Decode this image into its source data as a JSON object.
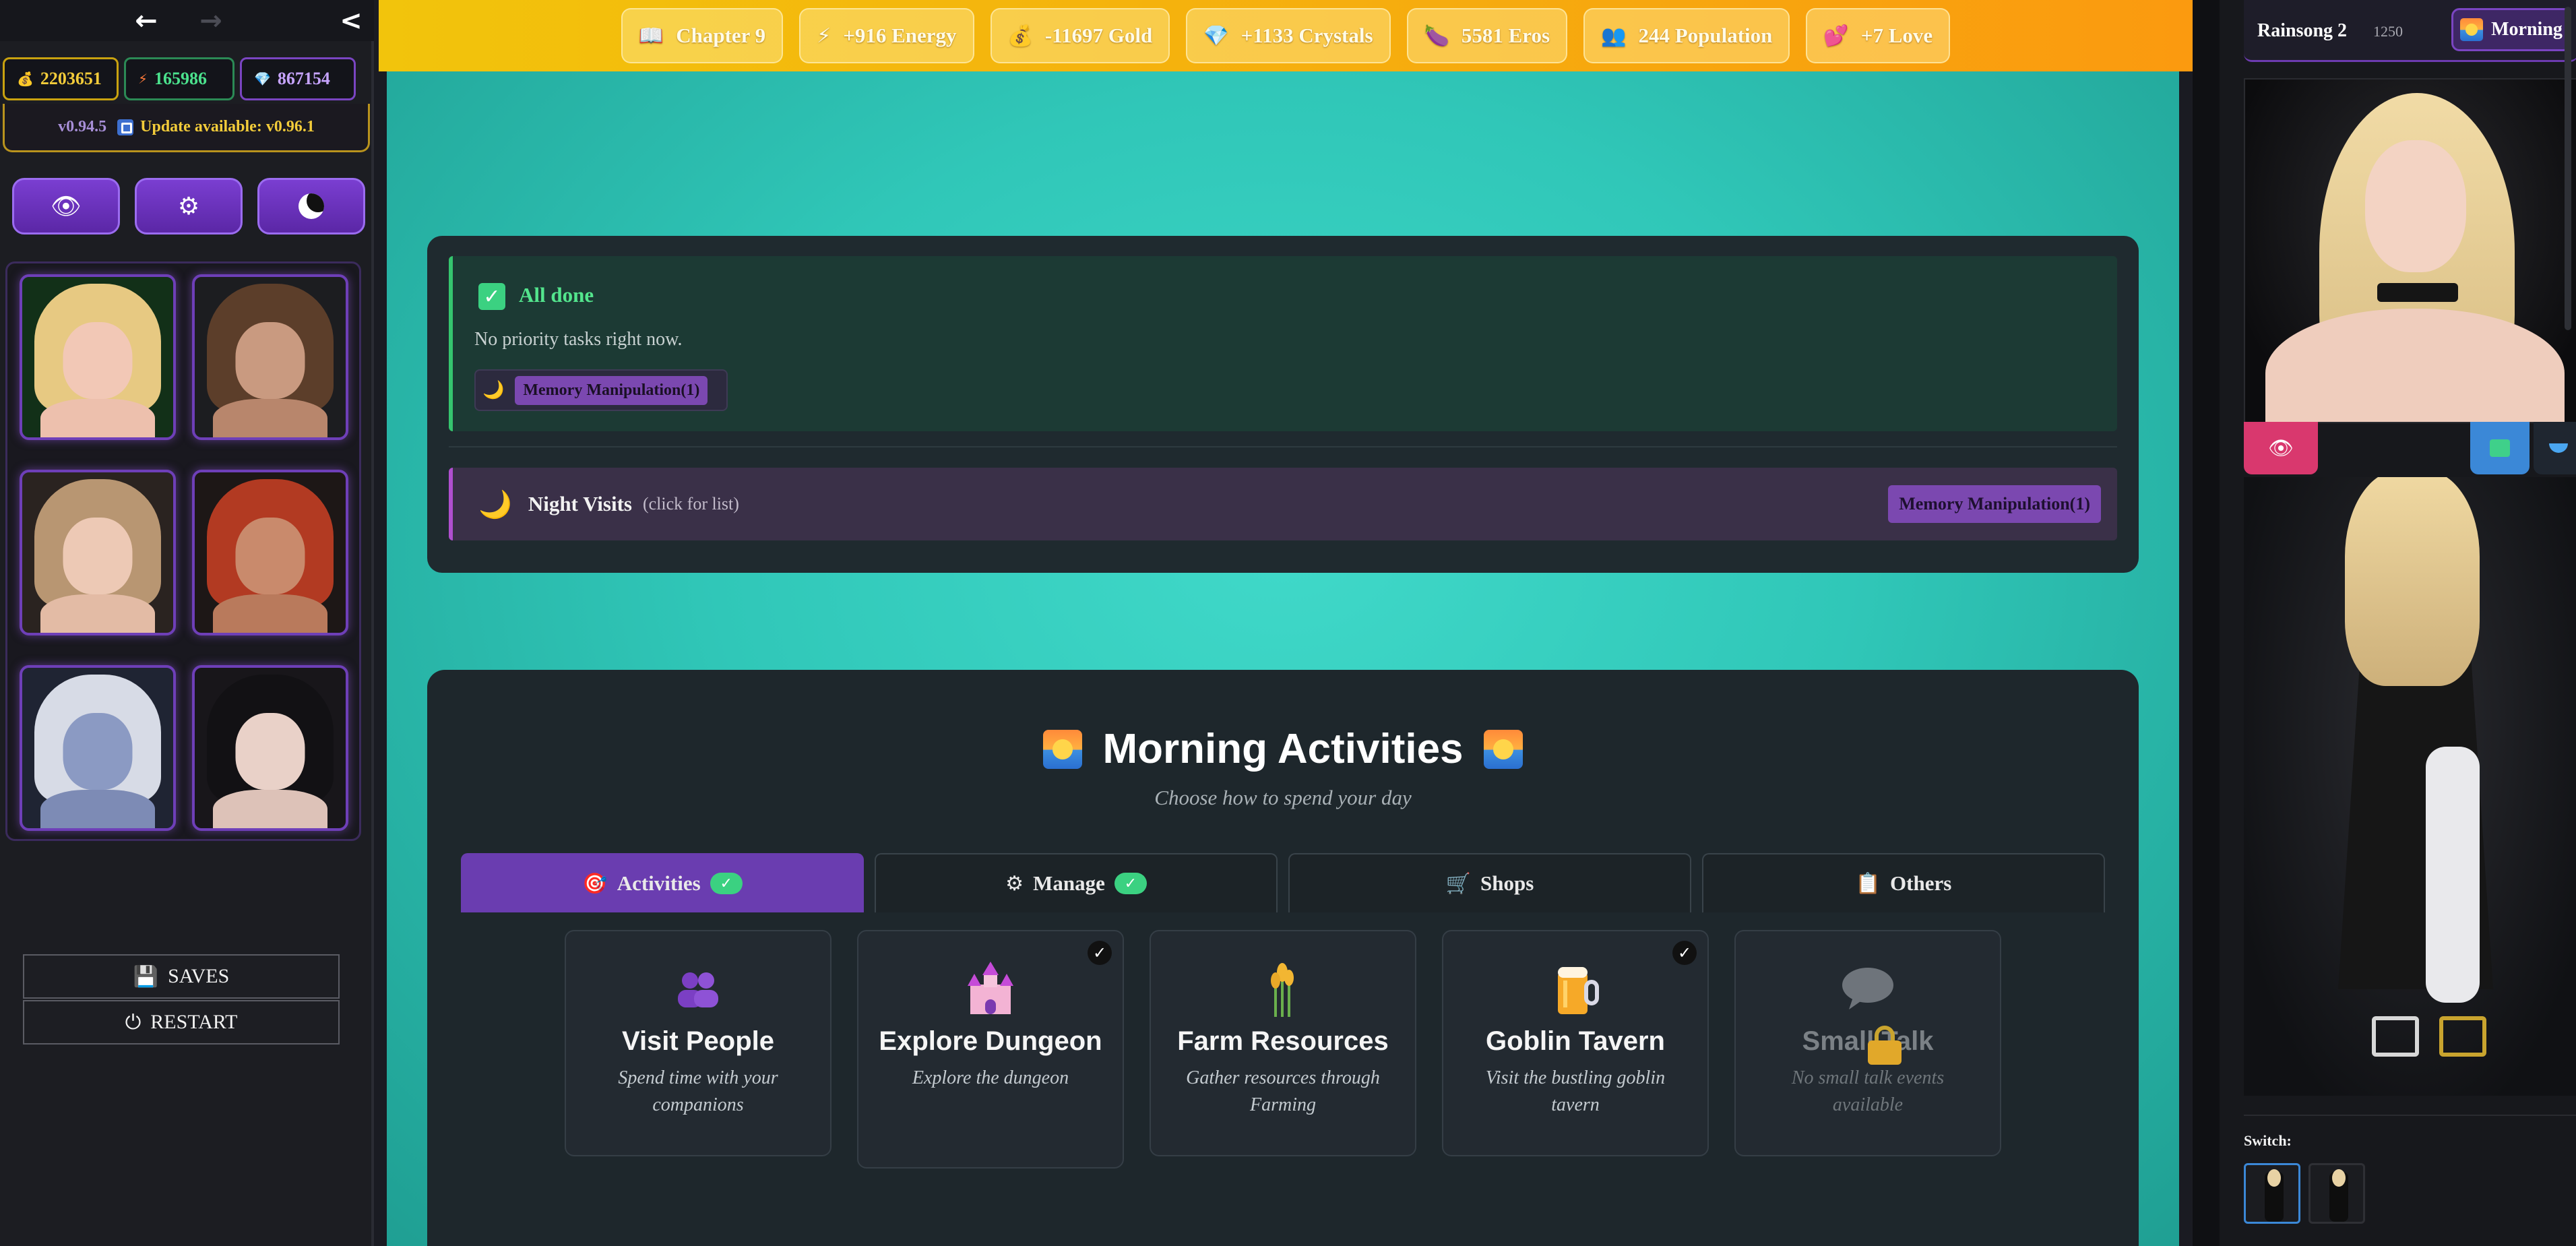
{
  "nav": {
    "back": "←",
    "forward": "→",
    "collapse": "<"
  },
  "currencies": [
    {
      "icon": "💰",
      "value": "2203651"
    },
    {
      "icon": "⚡",
      "value": "165986"
    },
    {
      "icon": "💎",
      "value": "867154"
    }
  ],
  "version": {
    "current": "v0.94.5",
    "update": "Update available: v0.96.1"
  },
  "tools": {
    "eye": "👁",
    "gear": "⚙"
  },
  "system": {
    "saves": "SAVES",
    "restart": "RESTART",
    "saves_icon": "💾",
    "restart_icon": "⏻"
  },
  "resources": [
    {
      "icon": "📖",
      "label": "Chapter 9"
    },
    {
      "icon": "⚡",
      "label": "+916 Energy"
    },
    {
      "icon": "💰",
      "label": "-11697 Gold"
    },
    {
      "icon": "💎",
      "label": "+1133 Crystals"
    },
    {
      "icon": "🍆",
      "label": "5581 Eros"
    },
    {
      "icon": "👥",
      "label": "244 Population"
    },
    {
      "icon": "💕",
      "label": "+7 Love"
    }
  ],
  "priority": {
    "check": "✓",
    "title": "All done",
    "subtitle": "No priority tasks right now.",
    "chip_icon": "🌙",
    "chip_label": "Memory Manipulation(1)"
  },
  "night": {
    "icon": "🌙",
    "title": "Night Visits",
    "hint": "(click for list)",
    "badge": "Memory Manipulation(1)"
  },
  "activities": {
    "title": "Morning Activities",
    "subtitle": "Choose how to spend your day",
    "tabs": [
      {
        "icon": "🎯",
        "label": "Activities",
        "done": "✓"
      },
      {
        "icon": "⚙",
        "label": "Manage",
        "done": "✓"
      },
      {
        "icon": "🛒",
        "label": "Shops"
      },
      {
        "icon": "📋",
        "label": "Others"
      }
    ],
    "cards": [
      {
        "title": "Visit People",
        "desc": "Spend time with your companions",
        "icon": "people-icon"
      },
      {
        "title": "Explore Dungeon",
        "desc": "Explore the dungeon",
        "icon": "castle-icon",
        "check": "✓"
      },
      {
        "title": "Farm Resources",
        "desc": "Gather resources through Farming",
        "icon": "wheat-icon"
      },
      {
        "title": "Goblin Tavern",
        "desc": "Visit the bustling goblin tavern",
        "icon": "beer-mug-icon",
        "check": "✓"
      },
      {
        "title": "Small Talk",
        "desc": "No small talk events available",
        "icon": "speech-bubble-icon"
      }
    ]
  },
  "profile": {
    "name": "Rainsong 2",
    "number": "1250",
    "time": "Morning",
    "eye_icon": "👁",
    "switch_label": "Switch:"
  },
  "colors": {
    "accent_purple": "#6a3db0",
    "topbar_gold": "#f2c40c",
    "teal_bg": "#30c7b8",
    "success_green": "#3bd181"
  }
}
